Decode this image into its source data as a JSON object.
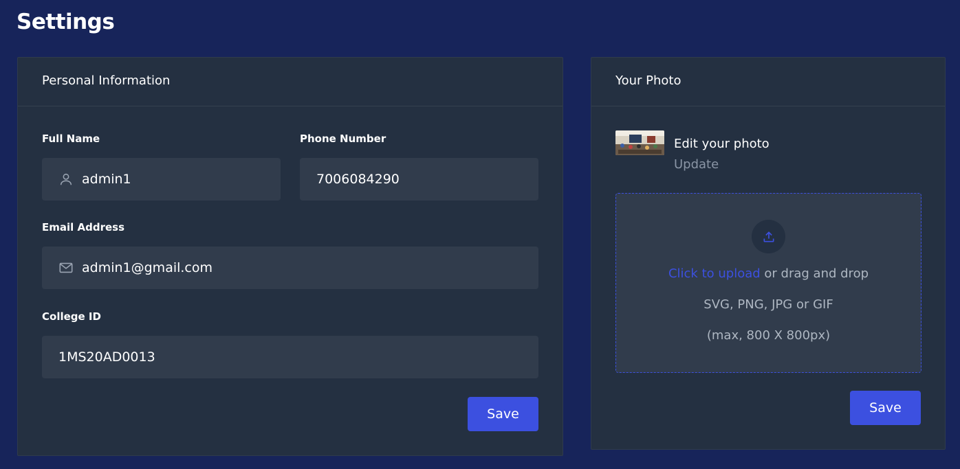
{
  "page": {
    "title": "Settings"
  },
  "personal": {
    "header": "Personal Information",
    "full_name": {
      "label": "Full Name",
      "value": "admin1"
    },
    "phone": {
      "label": "Phone Number",
      "value": "7006084290"
    },
    "email": {
      "label": "Email Address",
      "value": "admin1@gmail.com"
    },
    "college_id": {
      "label": "College ID",
      "value": "1MS20AD0013"
    },
    "save_label": "Save"
  },
  "photo": {
    "header": "Your Photo",
    "edit_label": "Edit your photo",
    "update_label": "Update",
    "upload": {
      "link_text": "Click to upload",
      "rest_text": " or drag and drop",
      "formats": "SVG, PNG, JPG or GIF",
      "max_size": "(max, 800 X 800px)"
    },
    "save_label": "Save"
  },
  "colors": {
    "background": "#17245a",
    "card": "#243041",
    "input": "#313c4c",
    "primary": "#3c50e0"
  },
  "icons": {
    "name_field": "user-icon",
    "email_field": "mail-icon",
    "upload": "upload-icon"
  }
}
